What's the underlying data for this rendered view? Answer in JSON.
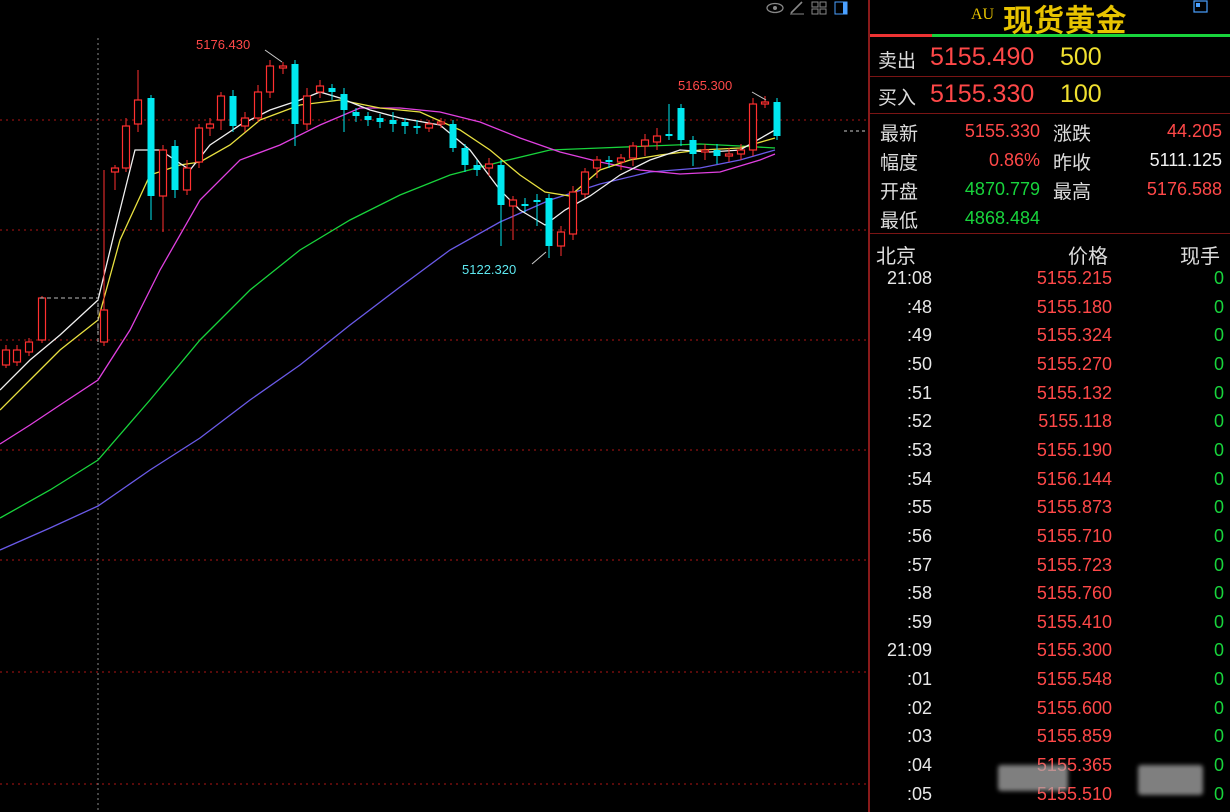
{
  "chart_data": {
    "type": "candlestick",
    "annotations": {
      "high1": "5176.430",
      "high2": "5165.300",
      "low1": "5122.320"
    },
    "colors": {
      "up": "#ff3030",
      "down": "#00e8f0",
      "ma1": "#f0f0f0",
      "ma2": "#e8e040",
      "ma3": "#e040e0",
      "ma4": "#18d43c",
      "ma5": "#6a5ae8",
      "grid": "#c01818"
    }
  },
  "panel": {
    "symbol_code": "AU",
    "title": "现货黄金",
    "sell": {
      "label": "卖出",
      "price": "5155.490",
      "volume": "500"
    },
    "buy": {
      "label": "买入",
      "price": "5155.330",
      "volume": "100"
    },
    "stats": {
      "latest_label": "最新",
      "latest": "5155.330",
      "change_label": "涨跌",
      "change": "44.205",
      "range_label": "幅度",
      "range": "0.86%",
      "prev_close_label": "昨收",
      "prev_close": "5111.125",
      "open_label": "开盘",
      "open": "4870.779",
      "high_label": "最高",
      "high": "5176.588",
      "low_label": "最低",
      "low": "4868.484"
    },
    "ticks_header": {
      "time": "北京",
      "price": "价格",
      "volume": "现手"
    },
    "ticks": [
      {
        "time": "21:08",
        "price": "5155.215",
        "volume": "0"
      },
      {
        "time": ":48",
        "price": "5155.180",
        "volume": "0"
      },
      {
        "time": ":49",
        "price": "5155.324",
        "volume": "0"
      },
      {
        "time": ":50",
        "price": "5155.270",
        "volume": "0"
      },
      {
        "time": ":51",
        "price": "5155.132",
        "volume": "0"
      },
      {
        "time": ":52",
        "price": "5155.118",
        "volume": "0"
      },
      {
        "time": ":53",
        "price": "5155.190",
        "volume": "0"
      },
      {
        "time": ":54",
        "price": "5156.144",
        "volume": "0"
      },
      {
        "time": ":55",
        "price": "5155.873",
        "volume": "0"
      },
      {
        "time": ":56",
        "price": "5155.710",
        "volume": "0"
      },
      {
        "time": ":57",
        "price": "5155.723",
        "volume": "0"
      },
      {
        "time": ":58",
        "price": "5155.760",
        "volume": "0"
      },
      {
        "time": ":59",
        "price": "5155.410",
        "volume": "0"
      },
      {
        "time": "21:09",
        "price": "5155.300",
        "volume": "0"
      },
      {
        "time": ":01",
        "price": "5155.548",
        "volume": "0"
      },
      {
        "time": ":02",
        "price": "5155.600",
        "volume": "0"
      },
      {
        "time": ":03",
        "price": "5155.859",
        "volume": "0"
      },
      {
        "time": ":04",
        "price": "5155.365",
        "volume": "0"
      },
      {
        "time": ":05",
        "price": "5155.510",
        "volume": "0"
      }
    ]
  }
}
